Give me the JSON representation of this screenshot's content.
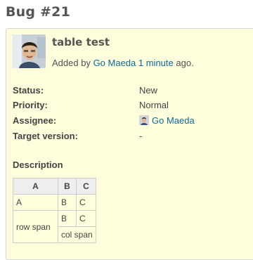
{
  "issue": {
    "title": "Bug #21",
    "subject": "table test",
    "added_by_prefix": "Added by",
    "author": "Go Maeda",
    "time_ago": "1 minute",
    "suffix": "ago."
  },
  "attributes": [
    {
      "label": "Status:",
      "value": "New"
    },
    {
      "label": "Priority:",
      "value": "Normal"
    },
    {
      "label": "Assignee:",
      "value": "Go Maeda"
    },
    {
      "label": "Target version:",
      "value": "-"
    }
  ],
  "description": {
    "label": "Description",
    "table": {
      "headers": [
        "A",
        "B",
        "C"
      ],
      "row1": [
        "A",
        "B",
        "C"
      ],
      "row2": [
        "row span",
        "B",
        "C"
      ],
      "row3": [
        "col span"
      ]
    }
  },
  "colors": {
    "box_background": "#ffffdd",
    "link": "#116699",
    "table_header_bg": "#eeeeee"
  },
  "icons": {
    "author_avatar": "user-photo-icon",
    "assignee_avatar": "user-photo-icon"
  }
}
